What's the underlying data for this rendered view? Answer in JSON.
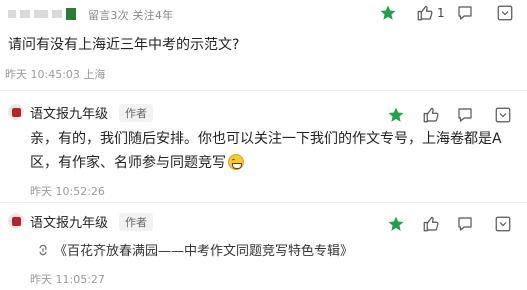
{
  "question": {
    "stats": "留言3次 关注4年",
    "text": "请问有没有上海近三年中考的示范文?",
    "time": "昨天 10:45:03 上海",
    "like_count": "1"
  },
  "replies": [
    {
      "author": "语文报九年级",
      "badge": "作者",
      "body": "亲，有的，我们随后安排。你也可以关注一下我们的作文专号，上海卷都是A区，有作家、名师参与同题竞写",
      "emoji": "grin-sweat-emoji",
      "time": "昨天 10:52:26"
    },
    {
      "author": "语文报九年级",
      "badge": "作者",
      "link_text": "《百花齐放春满园——中考作文同题竞写特色专辑》",
      "time": "昨天 11:05:27"
    }
  ],
  "icons": {
    "star": "star-icon",
    "like": "thumbs-up-icon",
    "reply": "comment-icon",
    "link": "link-icon"
  },
  "colors": {
    "star_green": "#22a04a",
    "brand_red": "#b5232d",
    "muted": "#9a9a9a"
  }
}
